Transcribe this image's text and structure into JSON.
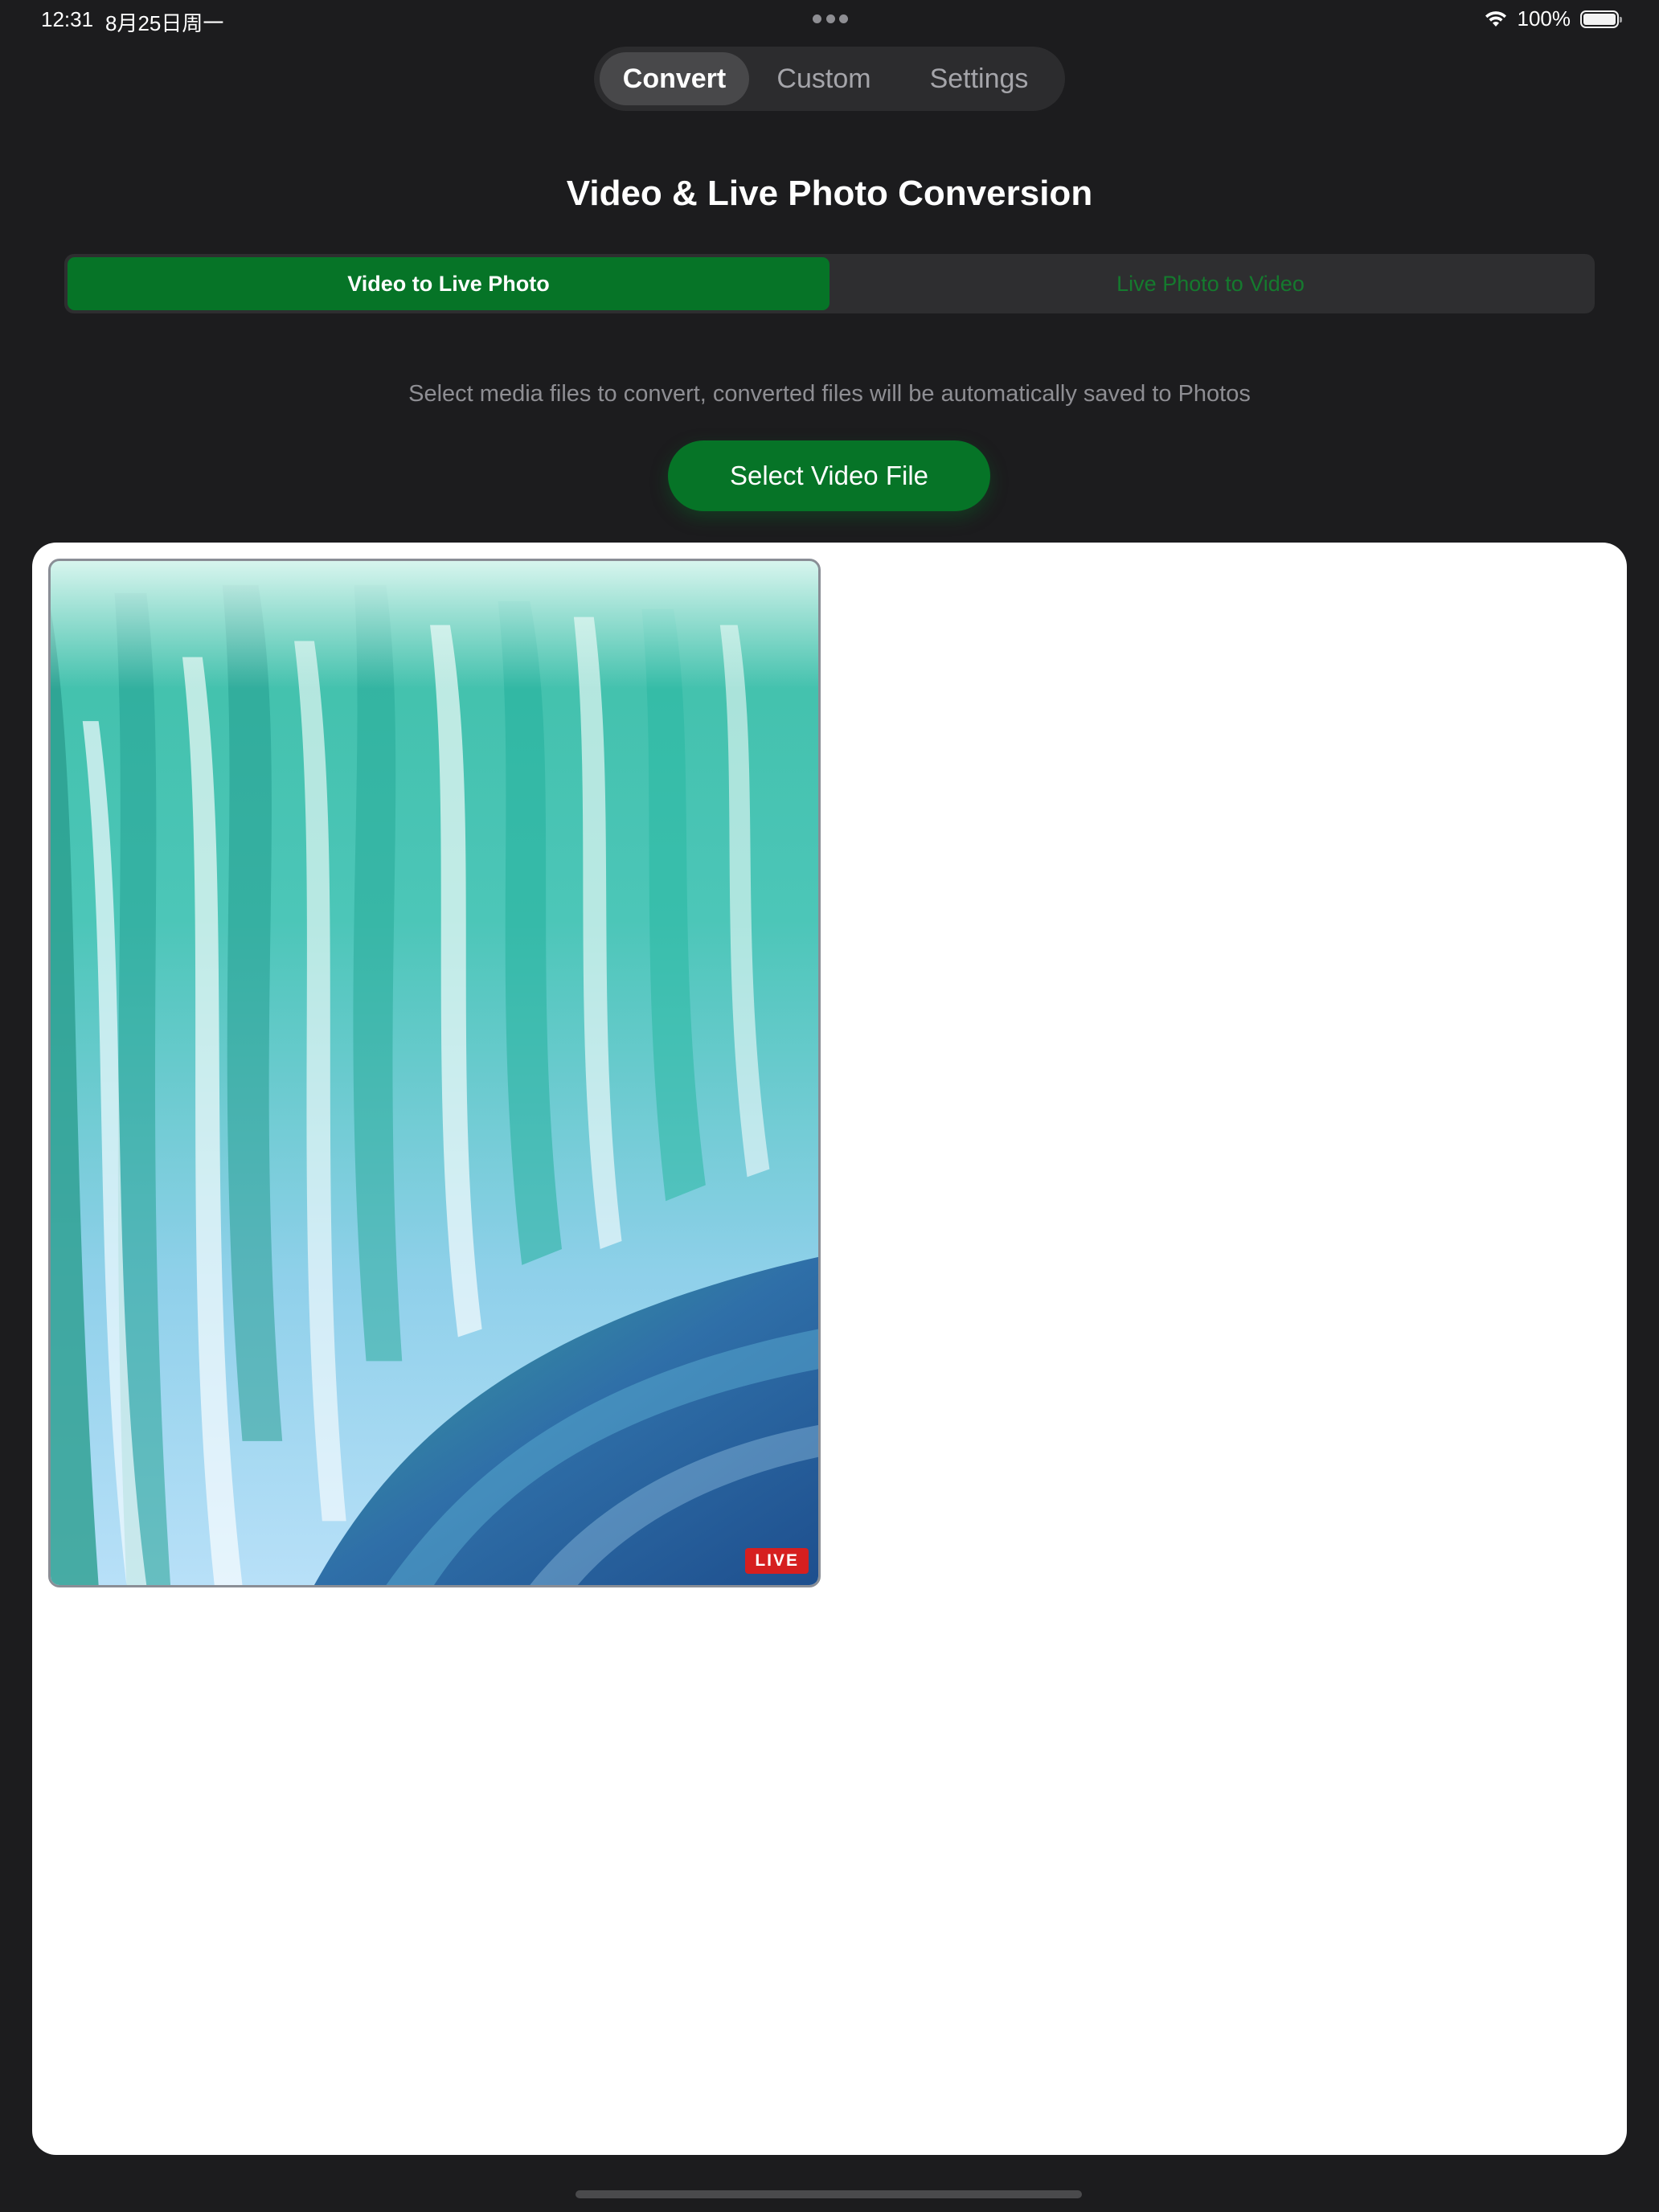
{
  "status_bar": {
    "time": "12:31",
    "date": "8月25日周一",
    "battery": "100%",
    "icons": [
      "wifi-icon",
      "battery-icon"
    ]
  },
  "top_tabs": [
    {
      "label": "Convert",
      "active": true
    },
    {
      "label": "Custom",
      "active": false
    },
    {
      "label": "Settings",
      "active": false
    }
  ],
  "title": "Video & Live Photo Conversion",
  "mode_control": {
    "options": [
      {
        "label": "Video to Live Photo",
        "selected": true
      },
      {
        "label": "Live Photo to Video",
        "selected": false
      }
    ]
  },
  "instructions": "Select media files to convert, converted files will be automatically saved to Photos",
  "select_button": "Select Video File",
  "items": [
    {
      "badge": "LIVE",
      "thumbnail_icon": "waterfall-image"
    }
  ],
  "colors": {
    "background": "#1c1c1e",
    "accent_green": "#067427",
    "live_badge": "#d61f1f",
    "panel": "#ffffff"
  }
}
